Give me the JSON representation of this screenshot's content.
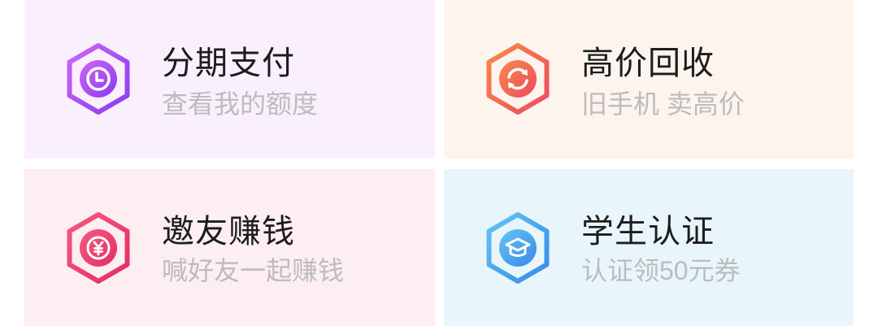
{
  "cards": [
    {
      "title": "分期支付",
      "subtitle": "查看我的额度",
      "icon": "clock-icon",
      "background": "#faf0fd",
      "colors": [
        "#cd66f6",
        "#8a3bef"
      ]
    },
    {
      "title": "高价回收",
      "subtitle": "旧手机 卖高价",
      "icon": "refresh-icon",
      "background": "#fdf4ee",
      "colors": [
        "#f68a4a",
        "#ee4a5f"
      ]
    },
    {
      "title": "邀友赚钱",
      "subtitle": "喊好友一起赚钱",
      "icon": "yen-coin-icon",
      "background": "#fdeef2",
      "colors": [
        "#f65a80",
        "#e42d61"
      ]
    },
    {
      "title": "学生认证",
      "subtitle": "认证领50元券",
      "icon": "graduation-cap-icon",
      "background": "#e8f6fc",
      "colors": [
        "#64c4f3",
        "#3a89e8"
      ]
    }
  ]
}
